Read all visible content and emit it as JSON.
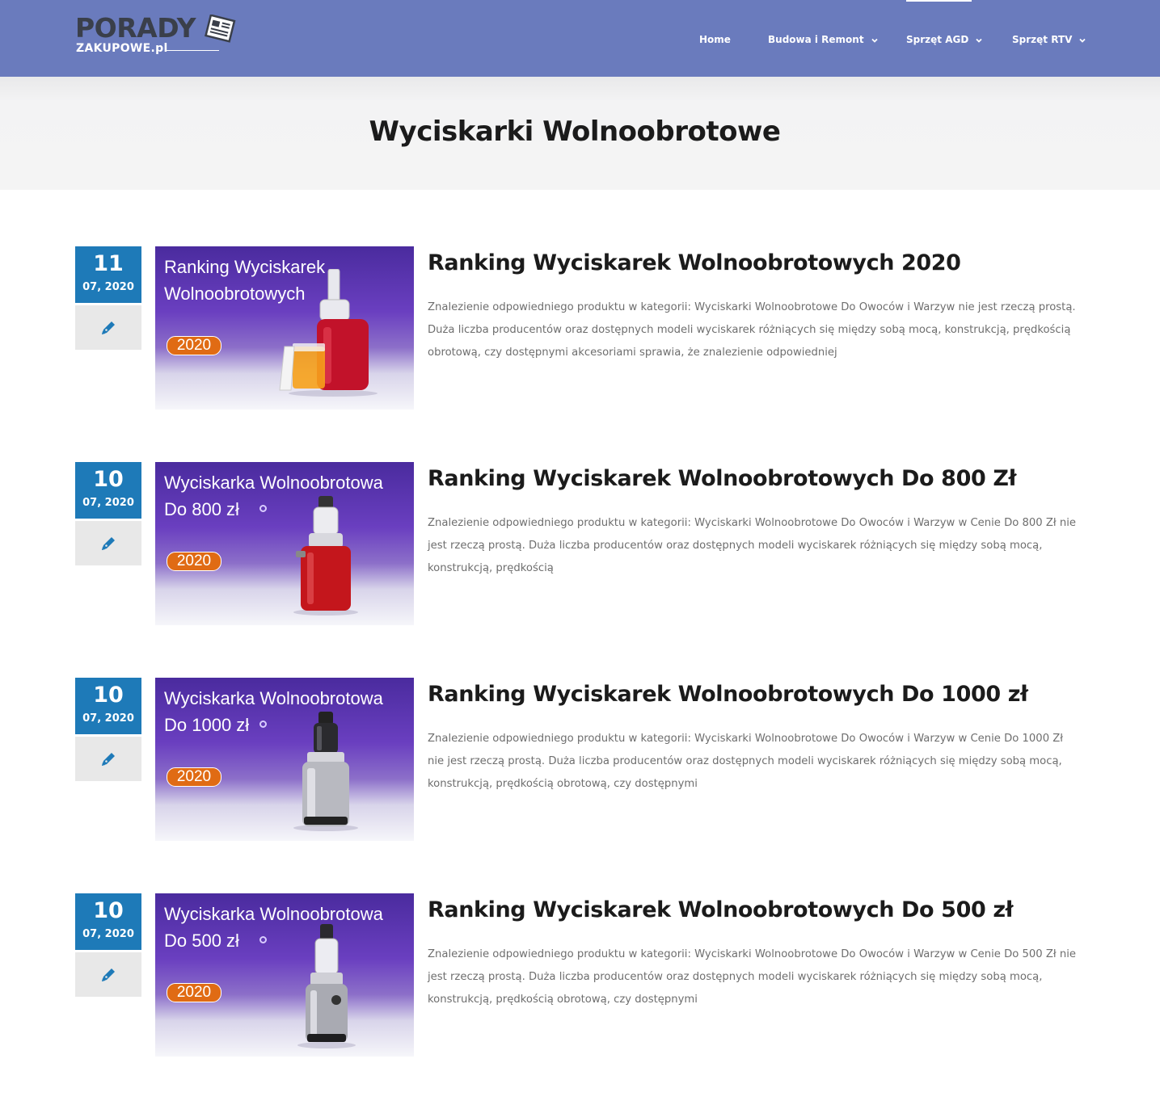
{
  "header": {
    "logo_word": "PORADY",
    "logo_sub": "ZAKUPOWE.pl",
    "nav": [
      {
        "label": "Home",
        "has_dropdown": false
      },
      {
        "label": "Budowa i Remont",
        "has_dropdown": true
      },
      {
        "label": "Sprzęt AGD",
        "has_dropdown": true
      },
      {
        "label": "Sprzęt RTV",
        "has_dropdown": true
      }
    ],
    "colors": {
      "header_bg": "#6a7bbd",
      "date_bg": "#1e7ab8",
      "badge": "#e06b14"
    }
  },
  "page": {
    "title": "Wyciskarki Wolnoobrotowe"
  },
  "posts": [
    {
      "day": "11",
      "month_year": "07, 2020",
      "format_icon": "pen-icon",
      "thumb": {
        "line1": "Ranking Wyciskarek",
        "line2": "Wolnoobrotowych",
        "badge": "2020"
      },
      "title": "Ranking Wyciskarek Wolnoobrotowych 2020",
      "excerpt": "Znalezienie odpowiedniego produktu w kategorii: Wyciskarki Wolnoobrotowe Do Owoców i Warzyw nie jest rzeczą prostą. Duża liczba producentów oraz dostępnych modeli wyciskarek różniących się między sobą mocą, konstrukcją, prędkością obrotową, czy dostępnymi akcesoriami sprawia, że znalezienie odpowiedniej"
    },
    {
      "day": "10",
      "month_year": "07, 2020",
      "format_icon": "pen-icon",
      "thumb": {
        "line1": "Wyciskarka Wolnoobrotowa",
        "line2": "Do 800 zł",
        "badge": "2020"
      },
      "title": "Ranking Wyciskarek Wolnoobrotowych Do 800 Zł",
      "excerpt": "Znalezienie odpowiedniego produktu w kategorii: Wyciskarki Wolnoobrotowe Do Owoców i Warzyw w Cenie Do 800 Zł nie jest rzeczą prostą. Duża liczba producentów oraz dostępnych modeli wyciskarek różniących się między sobą mocą, konstrukcją, prędkością"
    },
    {
      "day": "10",
      "month_year": "07, 2020",
      "format_icon": "pen-icon",
      "thumb": {
        "line1": "Wyciskarka Wolnoobrotowa",
        "line2": "Do 1000 zł",
        "badge": "2020"
      },
      "title": "Ranking Wyciskarek Wolnoobrotowych Do 1000 zł",
      "excerpt": "Znalezienie odpowiedniego produktu w kategorii: Wyciskarki Wolnoobrotowe Do Owoców i Warzyw w Cenie Do 1000 Zł nie jest rzeczą prostą. Duża liczba producentów oraz dostępnych modeli wyciskarek różniących się między sobą mocą, konstrukcją, prędkością obrotową, czy dostępnymi"
    },
    {
      "day": "10",
      "month_year": "07, 2020",
      "format_icon": "pen-icon",
      "thumb": {
        "line1": "Wyciskarka Wolnoobrotowa",
        "line2": "Do 500 zł",
        "badge": "2020"
      },
      "title": "Ranking Wyciskarek Wolnoobrotowych Do 500 zł",
      "excerpt": "Znalezienie odpowiedniego produktu w kategorii: Wyciskarki Wolnoobrotowe Do Owoców i Warzyw w Cenie Do 500 Zł nie jest rzeczą prostą. Duża liczba producentów oraz dostępnych modeli wyciskarek różniących się między sobą mocą, konstrukcją, prędkością obrotową, czy dostępnymi"
    }
  ]
}
